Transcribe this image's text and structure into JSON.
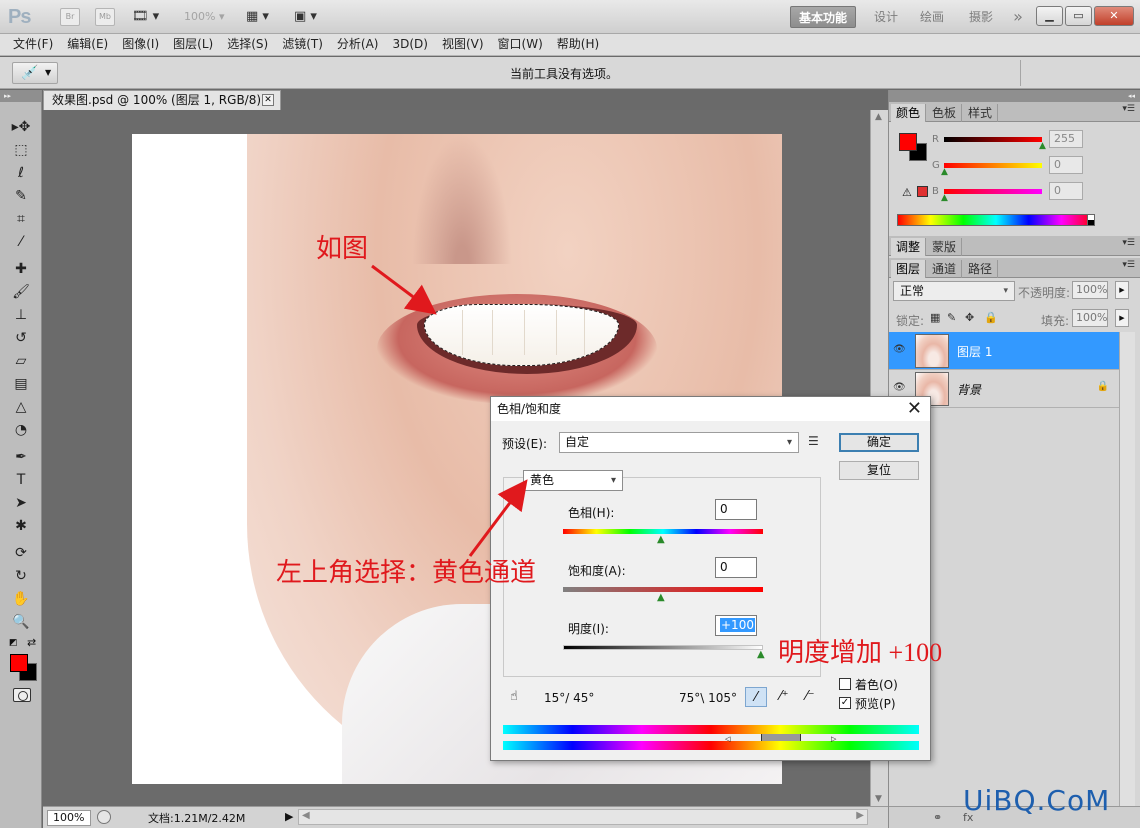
{
  "titlebar": {
    "logo": "Ps",
    "br": "Br",
    "mb": "Mb",
    "zoom": "100%",
    "workspaces": [
      "基本功能",
      "设计",
      "绘画",
      "摄影"
    ],
    "more": "»"
  },
  "menu": [
    "文件(F)",
    "编辑(E)",
    "图像(I)",
    "图层(L)",
    "选择(S)",
    "滤镜(T)",
    "分析(A)",
    "3D(D)",
    "视图(V)",
    "窗口(W)",
    "帮助(H)"
  ],
  "options": {
    "no_options": "当前工具没有选项。"
  },
  "document": {
    "tab_title": "效果图.psd @ 100% (图层 1, RGB/8) *",
    "zoom": "100%",
    "info": "文档:1.21M/2.42M"
  },
  "annotations": {
    "top": "如图",
    "left": "左上角选择：黄色通道",
    "right": "明度增加 +100"
  },
  "dialog": {
    "title": "色相/饱和度",
    "preset_label": "预设(E):",
    "preset_value": "自定",
    "ok": "确定",
    "reset": "复位",
    "channel": "黄色",
    "hue_label": "色相(H):",
    "hue_value": "0",
    "sat_label": "饱和度(A):",
    "sat_value": "0",
    "light_label": "明度(I):",
    "light_value": "+100",
    "range_left": "15°/ 45°",
    "range_right": "75°\\ 105°",
    "colorize": "着色(O)",
    "colorize_checked": false,
    "preview": "预览(P)",
    "preview_checked": true
  },
  "color_panel": {
    "tabs": [
      "颜色",
      "色板",
      "样式"
    ],
    "r_label": "R",
    "g_label": "G",
    "b_label": "B",
    "r": "255",
    "g": "0",
    "b": "0",
    "foreground": "#ff0000",
    "background": "#000000"
  },
  "adjust_panel": {
    "tabs": [
      "调整",
      "蒙版"
    ]
  },
  "layers_panel": {
    "tabs": [
      "图层",
      "通道",
      "路径"
    ],
    "blend_mode": "正常",
    "opacity_label": "不透明度:",
    "opacity": "100%",
    "lock_label": "锁定:",
    "fill_label": "填充:",
    "fill": "100%",
    "layers": [
      {
        "name": "图层 1",
        "selected": true
      },
      {
        "name": "背景",
        "selected": false
      }
    ]
  },
  "watermark": "UiBQ.CoM"
}
